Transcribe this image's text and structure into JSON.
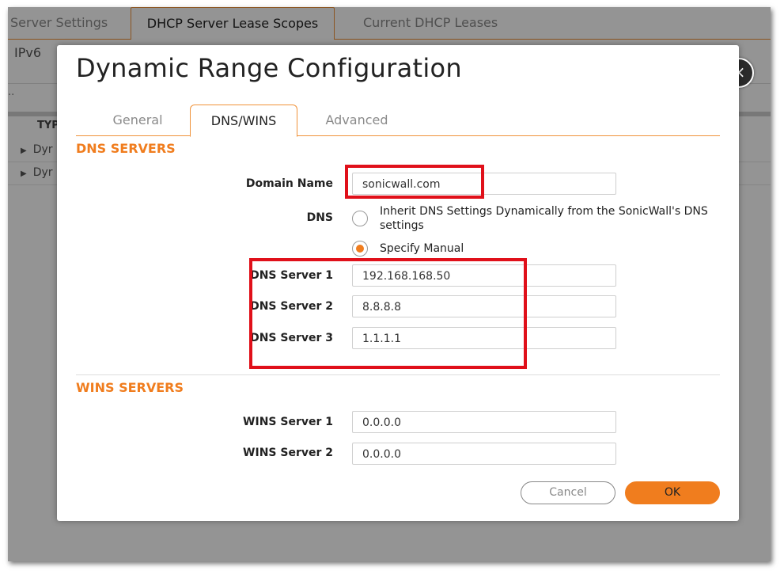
{
  "background": {
    "tabs": [
      "Server Settings",
      "DHCP Server Lease Scopes",
      "Current DHCP Leases"
    ],
    "active_tab": "DHCP Server Lease Scopes",
    "sub_label": "IPv6",
    "dots": "..",
    "column_header": "TYP",
    "rows": [
      "Dyr",
      "Dyr"
    ]
  },
  "dialog": {
    "title": "Dynamic Range Configuration",
    "close_icon": "×",
    "tabs": [
      {
        "label": "General",
        "active": false
      },
      {
        "label": "DNS/WINS",
        "active": true
      },
      {
        "label": "Advanced",
        "active": false
      }
    ],
    "dns_section": {
      "title": "DNS SERVERS",
      "domain_name_label": "Domain Name",
      "domain_name_value": "sonicwall.com",
      "dns_label": "DNS",
      "radio_inherit": "Inherit DNS Settings Dynamically from the SonicWall's DNS settings",
      "radio_manual": "Specify Manual",
      "selected": "manual",
      "servers": [
        {
          "label": "DNS Server 1",
          "value": "192.168.168.50"
        },
        {
          "label": "DNS Server 2",
          "value": "8.8.8.8"
        },
        {
          "label": "DNS Server 3",
          "value": "1.1.1.1"
        }
      ]
    },
    "wins_section": {
      "title": "WINS SERVERS",
      "servers": [
        {
          "label": "WINS Server 1",
          "value": "0.0.0.0"
        },
        {
          "label": "WINS Server 2",
          "value": "0.0.0.0"
        }
      ]
    },
    "buttons": {
      "cancel": "Cancel",
      "ok": "OK"
    }
  },
  "colors": {
    "accent": "#f07d1e",
    "highlight": "#e0101a"
  }
}
